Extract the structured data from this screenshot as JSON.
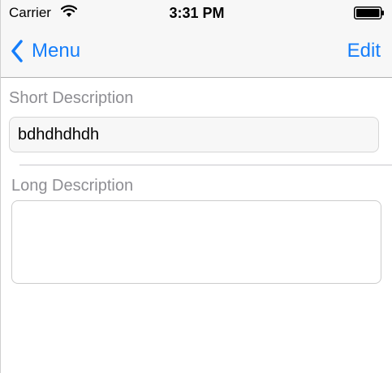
{
  "status_bar": {
    "carrier": "Carrier",
    "time": "3:31 PM",
    "wifi_icon": "wifi-icon",
    "battery_icon": "battery-icon"
  },
  "nav_bar": {
    "back_label": "Menu",
    "back_icon": "chevron-left-icon",
    "edit_label": "Edit"
  },
  "form": {
    "short_description_label": "Short Description",
    "short_description_value": "bdhdhdhdh",
    "long_description_label": "Long Description",
    "long_description_value": ""
  },
  "colors": {
    "accent": "#157efb",
    "label_gray": "#8e8e93",
    "bar_background": "#f7f7f7"
  }
}
